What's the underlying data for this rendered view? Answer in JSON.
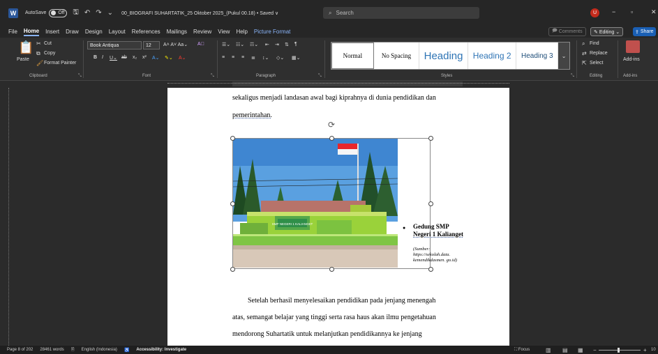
{
  "titlebar": {
    "autosave_label": "AutoSave",
    "autosave_state": "Off",
    "document_title": "00_BIOGRAFI SUHARTATIK_25 Oktober 2025_(Pukul 00.18) • Saved ∨",
    "search_placeholder": "Search",
    "avatar_initial": "U",
    "minimize": "−",
    "maximize": "▫",
    "close": "✕"
  },
  "menu": {
    "items": [
      "File",
      "Home",
      "Insert",
      "Draw",
      "Design",
      "Layout",
      "References",
      "Mailings",
      "Review",
      "View",
      "Help",
      "Picture Format"
    ],
    "active": "Home",
    "comments": "Comments",
    "editing": "Editing ⌄",
    "share": "Share"
  },
  "ribbon": {
    "clipboard": {
      "label": "Clipboard",
      "paste": "Paste",
      "cut": "Cut",
      "copy": "Copy",
      "format_painter": "Format Painter"
    },
    "font": {
      "label": "Font",
      "font_name": "Book Antiqua",
      "font_size": "12"
    },
    "paragraph": {
      "label": "Paragraph"
    },
    "styles": {
      "label": "Styles",
      "items": [
        "Normal",
        "No Spacing",
        "Heading",
        "Heading 2",
        "Heading 3"
      ]
    },
    "editing": {
      "label": "Editing",
      "find": "Find",
      "replace": "Replace",
      "select": "Select"
    },
    "addins": {
      "label": "Add-ins",
      "button": "Add-ins"
    }
  },
  "document": {
    "line1": "sekaligus menjadi landasan awal bagi kiprahnya di dunia pendidikan dan",
    "line2": "pemerintahan.",
    "caption_line1": "Gedung SMP",
    "caption_line2": "Negeri 1 Kalianget",
    "source_line1": "(Sumber:",
    "source_line2": "https://sekolah.data.",
    "source_line3": "kemendikdasmen. go.id)",
    "para2_line1": "Setelah berhasil menyelesaikan pendidikan pada jenjang menengah",
    "para2_line2": "atas, semangat belajar yang tinggi serta rasa haus akan ilmu pengetahuan",
    "para2_line3": "mendorong  Suhartatik  untuk  melanjutkan  pendidikannya  ke  jenjang",
    "school_sign": "SMP NEGERI 1 KALIANGET"
  },
  "statusbar": {
    "page": "Page 8 of 202",
    "words": "28461 words",
    "language": "English (Indonesia)",
    "accessibility": "Accessibility: Investigate",
    "focus": "Focus",
    "zoom_minus": "−",
    "zoom_plus": "+",
    "zoom_level": "10"
  },
  "colors": {
    "accent": "#2b579a",
    "share": "#1a5fb4",
    "heading": "#2e74b5"
  }
}
